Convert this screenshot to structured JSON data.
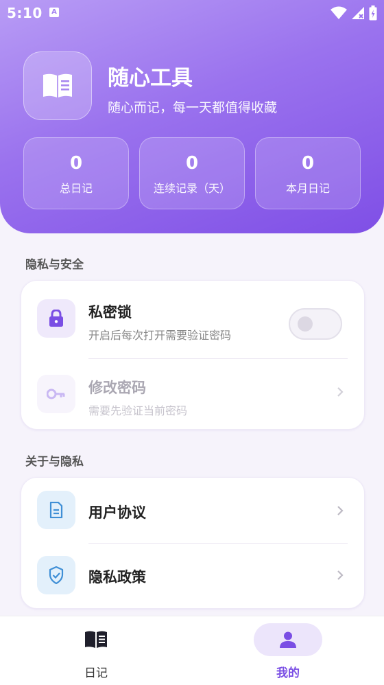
{
  "status": {
    "time": "5:10",
    "a_badge": "A"
  },
  "header": {
    "title": "随心工具",
    "subtitle": "随心而记，每一天都值得收藏"
  },
  "stats": [
    {
      "value": "0",
      "label": "总日记"
    },
    {
      "value": "0",
      "label": "连续记录（天）"
    },
    {
      "value": "0",
      "label": "本月日记"
    }
  ],
  "privacy_section": {
    "title": "隐私与安全",
    "lock": {
      "title": "私密锁",
      "desc": "开启后每次打开需要验证密码",
      "enabled": false
    },
    "change_password": {
      "title": "修改密码",
      "desc": "需要先验证当前密码"
    }
  },
  "about_section": {
    "title": "关于与隐私",
    "agreement": {
      "title": "用户协议"
    },
    "policy": {
      "title": "隐私政策"
    }
  },
  "nav": {
    "diary": "日记",
    "mine": "我的"
  },
  "colors": {
    "accent": "#7a4ee4",
    "hero_start": "#b89cf5",
    "hero_end": "#7f4fe6",
    "doc_icon": "#3f8fd6",
    "icon_bg_blue": "#e3f0fb"
  },
  "icons": {
    "logo": "book-icon",
    "lock": "lock-icon",
    "key": "key-icon",
    "agreement": "document-icon",
    "policy": "shield-check-icon",
    "nav_diary": "book-icon",
    "nav_mine": "user-icon"
  }
}
